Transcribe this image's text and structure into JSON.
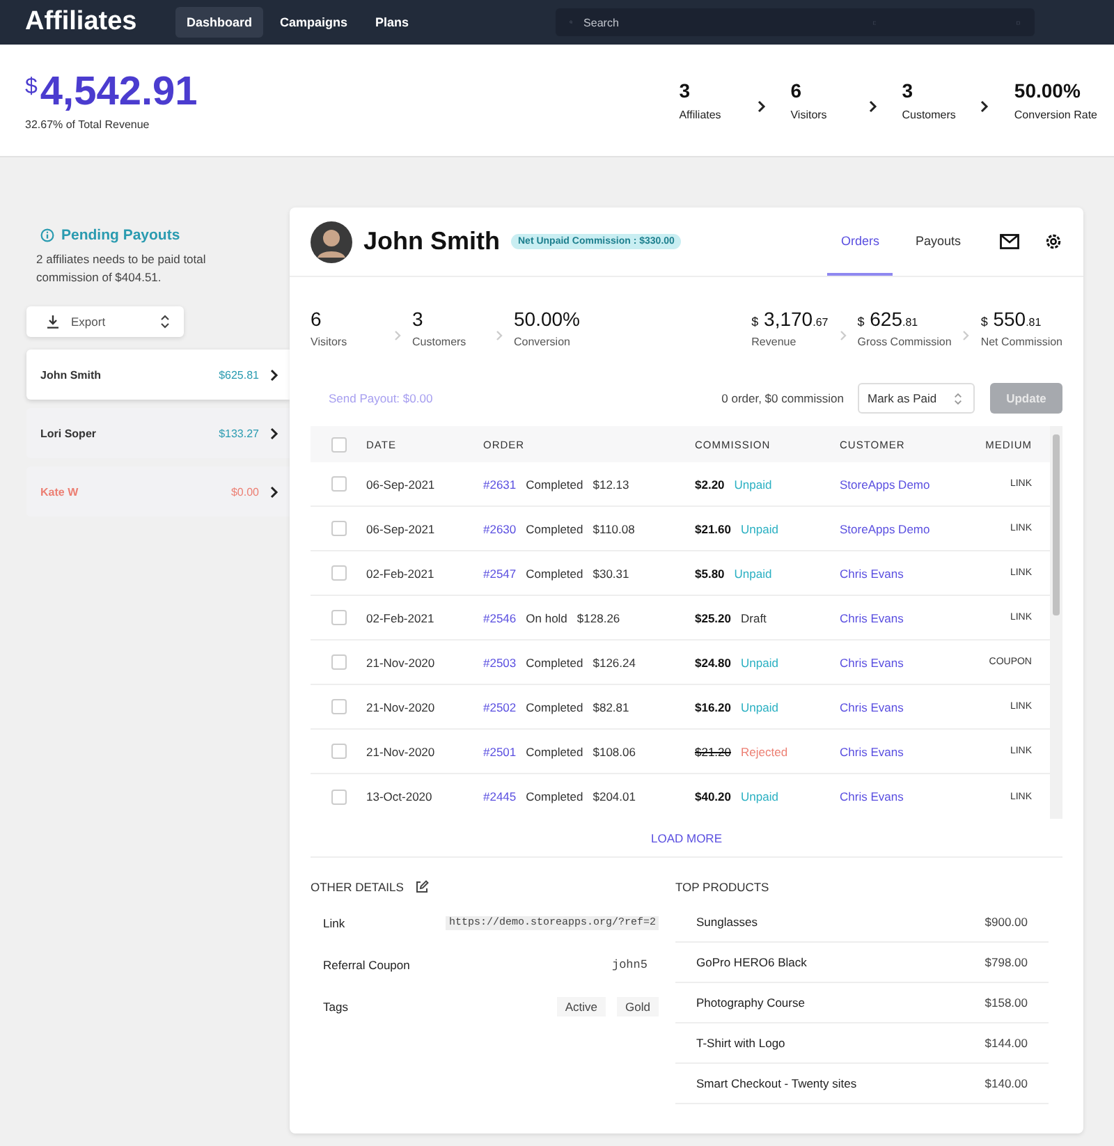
{
  "nav": {
    "brand": "Affiliates",
    "items": [
      {
        "label": "Dashboard",
        "selected": true
      },
      {
        "label": "Campaigns",
        "selected": false
      },
      {
        "label": "Plans",
        "selected": false
      }
    ],
    "search": {
      "placeholder": "Search"
    }
  },
  "summary": {
    "currency": "$",
    "amount": "4,542.91",
    "caption": "32.67% of Total Revenue",
    "stats": [
      {
        "value": "3",
        "label": "Affiliates"
      },
      {
        "value": "6",
        "label": "Visitors"
      },
      {
        "value": "3",
        "label": "Customers"
      },
      {
        "value": "50.00%",
        "label": "Conversion Rate"
      }
    ]
  },
  "pending": {
    "title": "Pending Payouts",
    "text": "2 affiliates needs to be paid total commission of $404.51.",
    "export": "Export",
    "affiliates": [
      {
        "name": "John Smith",
        "amount": "$625.81",
        "selected": true,
        "color": "#2a9bb0"
      },
      {
        "name": "Lori Soper",
        "amount": "$133.27",
        "selected": false,
        "color": "#2a9bb0"
      },
      {
        "name": "Kate W",
        "amount": "$0.00",
        "selected": false,
        "color": "#ec7f73"
      }
    ]
  },
  "profile": {
    "name": "John Smith",
    "badge": "Net Unpaid Commission : $330.00",
    "tabs": [
      {
        "label": "Orders",
        "selected": true
      },
      {
        "label": "Payouts",
        "selected": false
      }
    ],
    "stats": [
      {
        "value": "6",
        "label": "Visitors"
      },
      {
        "value": "3",
        "label": "Customers"
      },
      {
        "value": "50.00%",
        "label": "Conversion"
      }
    ],
    "money": [
      {
        "currency": "$",
        "whole": "3,170",
        "cents": ".67",
        "label": "Revenue"
      },
      {
        "currency": "$",
        "whole": "625",
        "cents": ".81",
        "label": "Gross Commission"
      },
      {
        "currency": "$",
        "whole": "550",
        "cents": ".81",
        "label": "Net Commission"
      }
    ]
  },
  "actions": {
    "send_payout": "Send Payout: $0.00",
    "count": "0 order, $0 commission",
    "select": "Mark as Paid",
    "update": "Update",
    "update_disabled": true
  },
  "table": {
    "columns": [
      "DATE",
      "ORDER",
      "COMMISSION",
      "CUSTOMER",
      "MEDIUM"
    ],
    "header_checked": false,
    "rows": [
      {
        "checked": false,
        "date": "06-Sep-2021",
        "order": "#2631",
        "order_status": "Completed",
        "total": "$12.13",
        "commission": "$2.20",
        "status": "Unpaid",
        "kind": "unpaid",
        "customer": "StoreApps Demo",
        "medium": "LINK"
      },
      {
        "checked": false,
        "date": "06-Sep-2021",
        "order": "#2630",
        "order_status": "Completed",
        "total": "$110.08",
        "commission": "$21.60",
        "status": "Unpaid",
        "kind": "unpaid",
        "customer": "StoreApps Demo",
        "medium": "LINK"
      },
      {
        "checked": false,
        "date": "02-Feb-2021",
        "order": "#2547",
        "order_status": "Completed",
        "total": "$30.31",
        "commission": "$5.80",
        "status": "Unpaid",
        "kind": "unpaid",
        "customer": "Chris Evans",
        "medium": "LINK"
      },
      {
        "checked": false,
        "date": "02-Feb-2021",
        "order": "#2546",
        "order_status": "On hold",
        "total": "$128.26",
        "commission": "$25.20",
        "status": "Draft",
        "kind": "draft",
        "customer": "Chris Evans",
        "medium": "LINK"
      },
      {
        "checked": false,
        "date": "21-Nov-2020",
        "order": "#2503",
        "order_status": "Completed",
        "total": "$126.24",
        "commission": "$24.80",
        "status": "Unpaid",
        "kind": "unpaid",
        "customer": "Chris Evans",
        "medium": "COUPON"
      },
      {
        "checked": false,
        "date": "21-Nov-2020",
        "order": "#2502",
        "order_status": "Completed",
        "total": "$82.81",
        "commission": "$16.20",
        "status": "Unpaid",
        "kind": "unpaid",
        "customer": "Chris Evans",
        "medium": "LINK"
      },
      {
        "checked": false,
        "date": "21-Nov-2020",
        "order": "#2501",
        "order_status": "Completed",
        "total": "$108.06",
        "commission": "$21.20",
        "status": "Rejected",
        "kind": "rejected",
        "customer": "Chris Evans",
        "medium": "LINK"
      },
      {
        "checked": false,
        "date": "13-Oct-2020",
        "order": "#2445",
        "order_status": "Completed",
        "total": "$204.01",
        "commission": "$40.20",
        "status": "Unpaid",
        "kind": "unpaid",
        "customer": "Chris Evans",
        "medium": "LINK"
      }
    ],
    "load_more": "LOAD MORE"
  },
  "details": {
    "title": "OTHER DETAILS",
    "link_label": "Link",
    "link": "https://demo.storeapps.org/?ref=2",
    "coupon_label": "Referral Coupon",
    "coupon": "john5",
    "tags_label": "Tags",
    "tags": [
      "Active",
      "Gold"
    ]
  },
  "products": {
    "title": "TOP PRODUCTS",
    "items": [
      {
        "name": "Sunglasses",
        "price": "$900.00"
      },
      {
        "name": "GoPro HERO6 Black",
        "price": "$798.00"
      },
      {
        "name": "Photography Course",
        "price": "$158.00"
      },
      {
        "name": "T-Shirt with Logo",
        "price": "$144.00"
      },
      {
        "name": "Smart Checkout - Twenty sites",
        "price": "$140.00"
      }
    ]
  }
}
